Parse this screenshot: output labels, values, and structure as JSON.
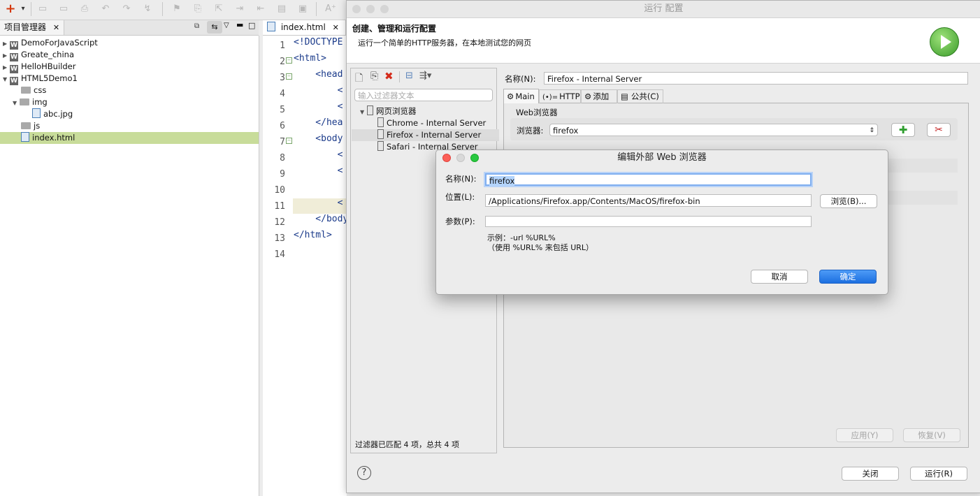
{
  "toolbar": {
    "new_icon": "+",
    "dropdown_icon": "▾",
    "font_icon": "A⁺"
  },
  "project_explorer": {
    "title": "项目管理器",
    "items": [
      {
        "label": "DemoForJavaScript"
      },
      {
        "label": "Greate_china"
      },
      {
        "label": "HelloHBuilder"
      },
      {
        "label": "HTML5Demo1"
      },
      {
        "label": "css"
      },
      {
        "label": "img"
      },
      {
        "label": "abc.jpg"
      },
      {
        "label": "js"
      },
      {
        "label": "index.html"
      }
    ]
  },
  "editor": {
    "tab_label": "index.html",
    "line_numbers": [
      "1",
      "2",
      "3",
      "4",
      "5",
      "6",
      "7",
      "8",
      "9",
      "10",
      "11",
      "12",
      "13",
      "14"
    ],
    "lines": {
      "l1": "<!DOCTYPE",
      "l2": "<html>",
      "l3": "    <head",
      "l4": "        <",
      "l5": "        <",
      "l6": "    </hea",
      "l7": "    <body",
      "l8": "        <",
      "l9": "        <",
      "l11": "        <",
      "l12": "    </body",
      "l13": "</html>"
    }
  },
  "run_config": {
    "window_title": "运行 配置",
    "banner_title": "创建、管理和运行配置",
    "banner_subtitle": "运行一个简单的HTTP服务器，在本地测试您的网页",
    "filter_placeholder": "输入过滤器文本",
    "tree_root": "网页浏览器",
    "tree_items": [
      "Chrome - Internal Server",
      "Firefox - Internal Server",
      "Safari - Internal Server"
    ],
    "filter_status": "过滤器已匹配 4 项，总共 4 项",
    "name_label": "名称(N):",
    "name_value": "Firefox - Internal Server",
    "tabs": [
      "Main",
      "HTTP",
      "添加",
      "公共(C)"
    ],
    "web_browser_group": "Web浏览器",
    "browser_label": "浏览器:",
    "browser_value": "firefox",
    "apply_button": "应用(Y)",
    "revert_button": "恢复(V)",
    "close_button": "关闭",
    "run_button": "运行(R)",
    "help_icon": "?"
  },
  "edit_browser": {
    "title": "编辑外部 Web 浏览器",
    "name_label": "名称(N):",
    "name_value": "firefox",
    "location_label": "位置(L):",
    "location_value": "/Applications/Firefox.app/Contents/MacOS/firefox-bin",
    "browse_button": "浏览(B)...",
    "params_label": "参数(P):",
    "params_value": "",
    "example_line1": "示例：-url %URL%",
    "example_line2": "（使用 %URL% 来包括 URL）",
    "cancel_button": "取消",
    "ok_button": "确定"
  },
  "colors": {
    "accent_blue": "#1c6fe0",
    "selection_green": "#c8dc9a",
    "close_red": "#fc5f57",
    "min_yellow": "#fdbc2e",
    "max_green": "#28c840"
  }
}
